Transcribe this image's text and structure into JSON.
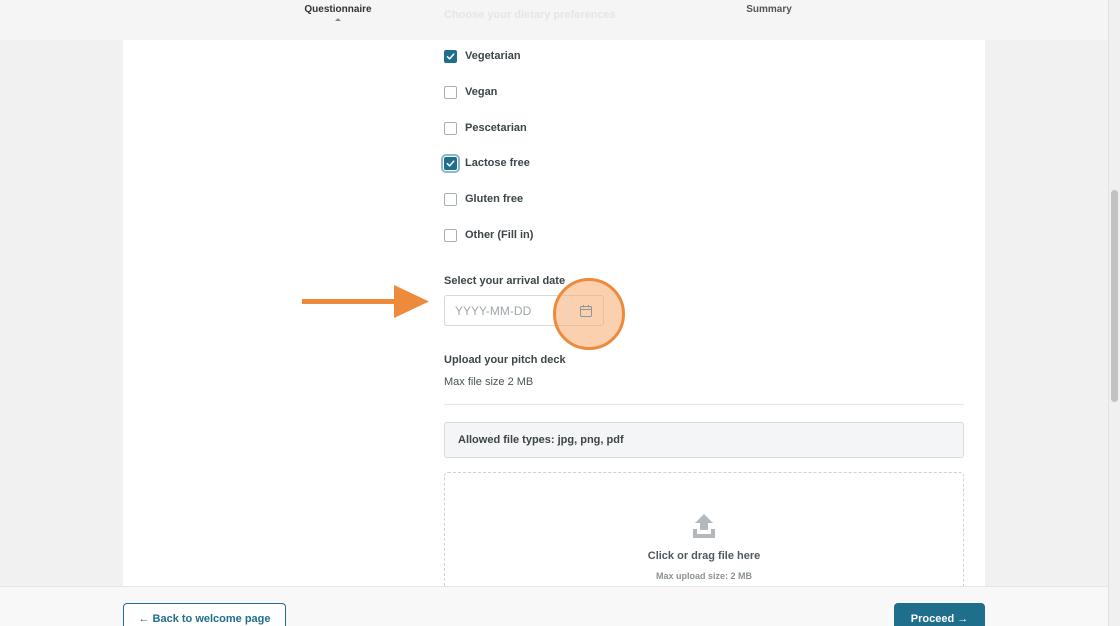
{
  "nav": {
    "tabs": [
      {
        "label": "Questionnaire",
        "active": true
      },
      {
        "label": "Summary",
        "active": false
      }
    ]
  },
  "question": {
    "heading": "Choose your dietary preferences",
    "options": [
      {
        "label": "Vegetarian",
        "checked": true
      },
      {
        "label": "Vegan",
        "checked": false
      },
      {
        "label": "Pescetarian",
        "checked": false
      },
      {
        "label": "Lactose free",
        "checked": true
      },
      {
        "label": "Gluten free",
        "checked": false
      },
      {
        "label": "Other (Fill in)",
        "checked": false
      }
    ]
  },
  "arrival": {
    "label": "Select your arrival date",
    "placeholder": "YYYY-MM-DD",
    "value": ""
  },
  "upload": {
    "label": "Upload your pitch deck",
    "max_size_text": "Max file size 2 MB",
    "allowed_types": "Allowed file types: jpg, png, pdf",
    "drop_title": "Click or drag file here",
    "drop_subtitle": "Max upload size: 2 MB"
  },
  "footer": {
    "back_label": "← Back to welcome page",
    "proceed_label": "Proceed →"
  },
  "colors": {
    "accent": "#1f6e8c",
    "annotation": "#ee8a3c"
  }
}
